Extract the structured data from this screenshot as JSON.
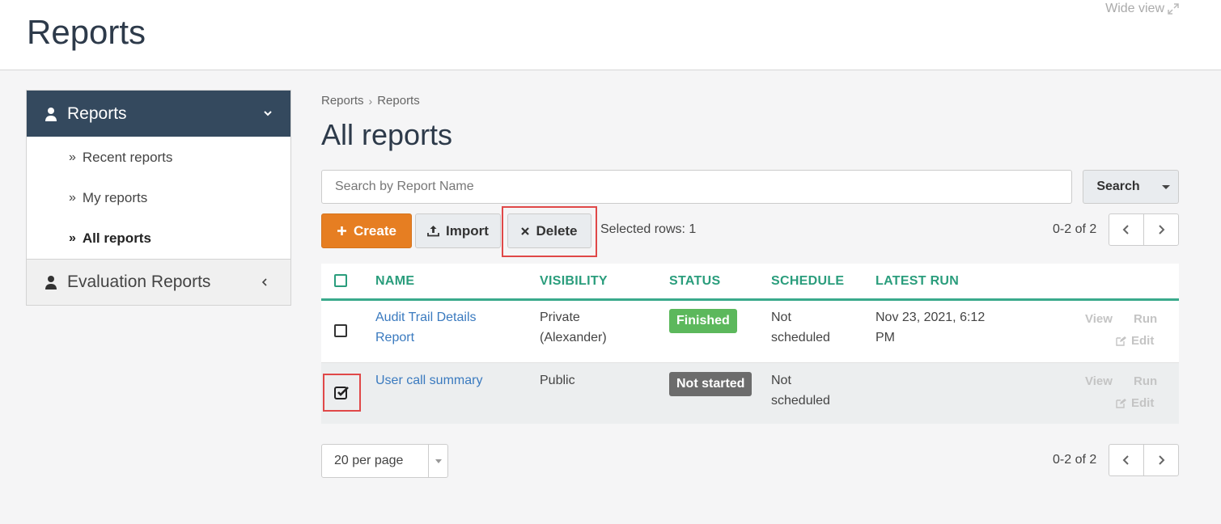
{
  "header": {
    "title": "Reports",
    "wide_view": "Wide view"
  },
  "sidebar": {
    "section_title": "Reports",
    "items": [
      {
        "label": "Recent reports"
      },
      {
        "label": "My reports"
      },
      {
        "label": "All reports"
      }
    ],
    "other_section": "Evaluation Reports"
  },
  "breadcrumb": [
    "Reports",
    "Reports"
  ],
  "main": {
    "title": "All reports",
    "search_placeholder": "Search by Report Name",
    "search_label": "Search",
    "create_label": "Create",
    "import_label": "Import",
    "delete_label": "Delete",
    "selected_rows": "Selected rows: 1",
    "pager_top": "0-2 of 2",
    "pager_bottom": "0-2 of 2",
    "per_page": "20 per page"
  },
  "table": {
    "columns": [
      "NAME",
      "VISIBILITY",
      "STATUS",
      "SCHEDULE",
      "LATEST RUN"
    ],
    "rows": [
      {
        "name_line1": "Audit Trail Details",
        "name_line2": "Report",
        "visibility_line1": "Private",
        "visibility_line2": "(Alexander)",
        "status": "Finished",
        "schedule_line1": "Not",
        "schedule_line2": "scheduled",
        "latest_line1": "Nov 23, 2021, 6:12",
        "latest_line2": "PM",
        "checked": false,
        "actions": {
          "view": "View",
          "run": "Run",
          "edit": "Edit"
        }
      },
      {
        "name_line1": "User call summary",
        "visibility_line1": "Public",
        "status": "Not started",
        "schedule_line1": "Not",
        "schedule_line2": "scheduled",
        "checked": true,
        "actions": {
          "view": "View",
          "run": "Run",
          "edit": "Edit"
        }
      }
    ]
  },
  "colors": {
    "sidebar_header": "#34495e",
    "accent_green": "#2a9d7c",
    "create_orange": "#e67e22",
    "finished_badge": "#5cb85c",
    "not_started_badge": "#6c6c6c",
    "highlight_red": "#e04848",
    "link_blue": "#3a7abf"
  }
}
